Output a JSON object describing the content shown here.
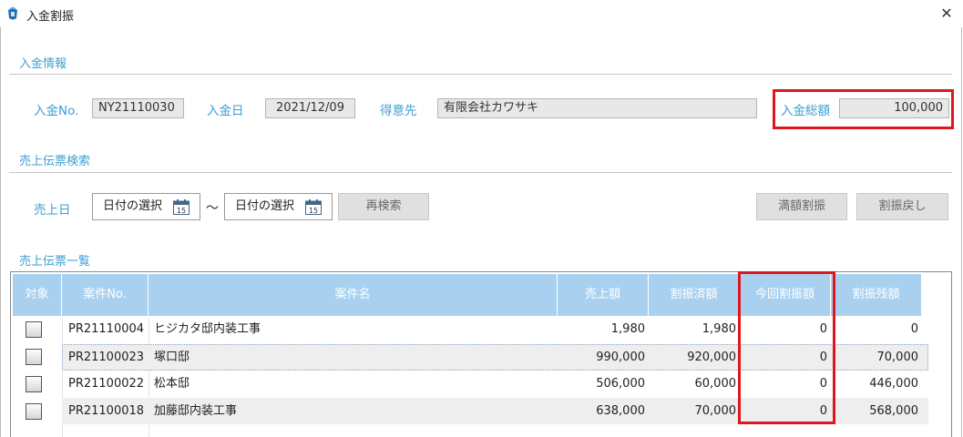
{
  "window": {
    "title": "入金割振",
    "close_glyph": "✕",
    "icon": "app-logo-icon"
  },
  "sections": {
    "payment_info": "入金情報",
    "search": "売上伝票検索",
    "list": "売上伝票一覧"
  },
  "payment": {
    "no_label": "入金No.",
    "no_value": "NY21110030",
    "date_label": "入金日",
    "date_value": "2021/12/09",
    "customer_label": "得意先",
    "customer_value": "有限会社カワサキ",
    "total_label": "入金総額",
    "total_value": "100,000"
  },
  "search": {
    "sales_date_label": "売上日",
    "from_placeholder": "日付の選択",
    "tilde": "～",
    "to_placeholder": "日付の選択",
    "calendar_number": "15",
    "research_button": "再検索",
    "full_allocate_button": "満額割振",
    "undo_allocate_button": "割振戻し"
  },
  "table": {
    "headers": [
      "対象",
      "案件No.",
      "案件名",
      "売上額",
      "割振済額",
      "今回割振額",
      "割振残額"
    ],
    "rows": [
      {
        "no": "PR21110004",
        "name": "ヒジカタ邸内装工事",
        "sales": "1,980",
        "allocated": "1,980",
        "current": "0",
        "remaining": "0",
        "checked": false
      },
      {
        "no": "PR21100023",
        "name": "塚口邸",
        "sales": "990,000",
        "allocated": "920,000",
        "current": "0",
        "remaining": "70,000",
        "checked": false
      },
      {
        "no": "PR21100022",
        "name": "松本邸",
        "sales": "506,000",
        "allocated": "60,000",
        "current": "0",
        "remaining": "446,000",
        "checked": false
      },
      {
        "no": "PR21100018",
        "name": "加藤邸内装工事",
        "sales": "638,000",
        "allocated": "70,000",
        "current": "0",
        "remaining": "568,000",
        "checked": false
      }
    ]
  },
  "colors": {
    "accent": "#3c9fd0",
    "header_bg": "#a9d1ef",
    "highlight": "#e0161f",
    "readonly_bg": "#e8e8e8"
  }
}
